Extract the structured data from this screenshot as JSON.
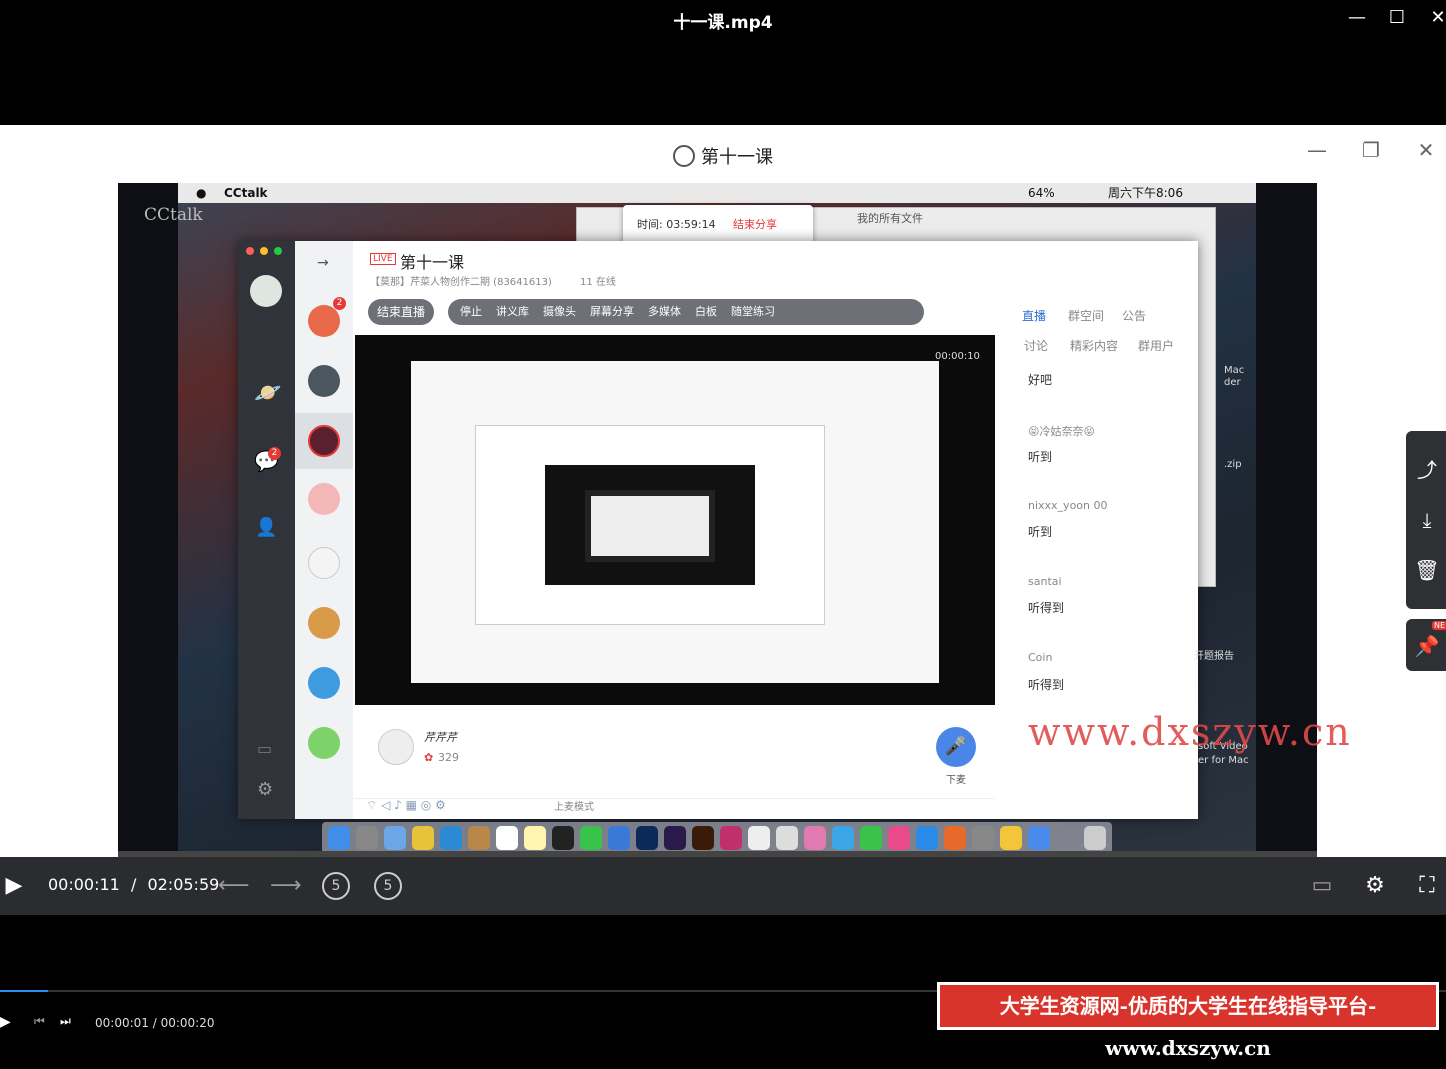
{
  "window": {
    "title": "十一课.mp4"
  },
  "player": {
    "title": "第十一课"
  },
  "video": {
    "watermark_left": "CCtalk",
    "mac_app": "CCtalk",
    "mac_status": "64%",
    "mac_clock": "周六下午8:06",
    "share_time": "时间: 03:59:14",
    "share_stop": "结束分享",
    "finder_title": "我的所有文件",
    "cc": {
      "live_badge": "LIVE",
      "title": "第十一课",
      "subtitle": "【莫那】芹菜人物创作二期 (83641613)",
      "online": "11 在线",
      "end_live": "结束直播",
      "toolbar": [
        "停止",
        "讲义库",
        "摄像头",
        "屏幕分享",
        "多媒体",
        "白板",
        "随堂练习"
      ],
      "tabs_top": [
        "直播",
        "群空间",
        "公告"
      ],
      "tabs_sub": [
        "讨论",
        "精彩内容",
        "群用户"
      ],
      "nested_timer": "00:00:10",
      "chat": [
        {
          "name": "",
          "msg": "好吧"
        },
        {
          "name": "😝冷姑奈奈😝",
          "msg": "听到"
        },
        {
          "name": "nixxx_yoon 00",
          "msg": "听到"
        },
        {
          "name": "santai",
          "msg": "听得到"
        },
        {
          "name": "Coin",
          "msg": "听得到"
        }
      ],
      "host_name": "芹芹芹",
      "host_flowers": "329",
      "mic_label": "下麦",
      "mode_label": "上麦模式",
      "badges": {
        "hot": "2",
        "chat": "2"
      }
    },
    "desktop_labels": [
      "Mac",
      "der",
      ".zip",
      "开题报告",
      "soft Video",
      "er for Mac"
    ]
  },
  "site_watermark": "www.dxszyw.cn",
  "controls": {
    "current": "00:00:11",
    "separator": "/",
    "duration": "02:05:59",
    "back_label": "5",
    "fwd_label": "5"
  },
  "lower": {
    "time": "00:00:01 / 00:00:20"
  },
  "banner": "大学生资源网-优质的大学生在线指导平台-www.dxszyw.cn",
  "side": {
    "new_badge": "NE"
  },
  "colors": {
    "accent": "#2d8cf0",
    "banner": "#d9342b",
    "live": "#e53935"
  }
}
